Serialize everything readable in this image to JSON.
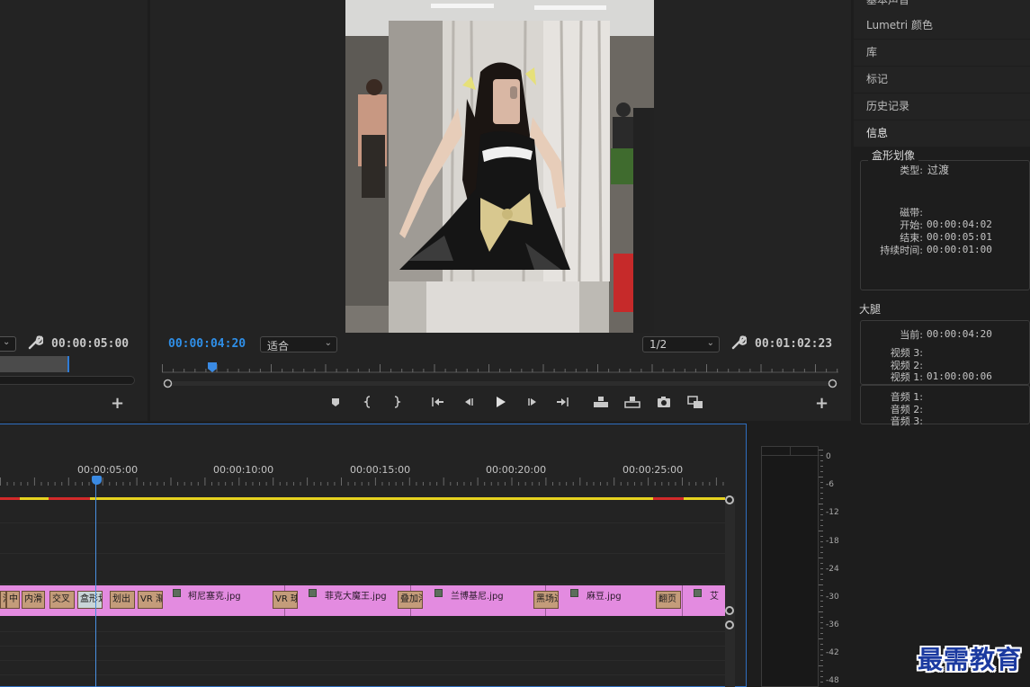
{
  "source_monitor": {
    "duration": "00:00:05:00",
    "add_label": "+"
  },
  "program_monitor": {
    "timecode": "00:00:04:20",
    "fit_option": "适合",
    "resolution": "1/2",
    "duration": "00:01:02:23",
    "add_label": "+",
    "transport_icons": [
      "marker-icon",
      "mark-in-icon",
      "mark-out-icon",
      "go-to-in-icon",
      "step-back-icon",
      "play-icon",
      "step-forward-icon",
      "go-to-out-icon",
      "lift-icon",
      "extract-icon",
      "export-frame-icon",
      "compare-icon"
    ]
  },
  "right_panel": {
    "top_cut_item": "基本声音",
    "items": [
      "Lumetri 颜色",
      "库",
      "标记",
      "历史记录",
      "信息"
    ],
    "info": {
      "title": "盒形划像",
      "type_label": "类型:",
      "type_value": "过渡",
      "tape_label": "磁带:",
      "start_label": "开始:",
      "start_value": "00:00:04:02",
      "end_label": "结束:",
      "end_value": "00:00:05:01",
      "duration_label": "持续时间:",
      "duration_value": "00:00:01:00"
    },
    "sequence": {
      "name": "大腿",
      "current_label": "当前:",
      "current_value": "00:00:04:20",
      "video3_label": "视频 3:",
      "video2_label": "视频 2:",
      "video1_label": "视频 1:",
      "video1_value": "01:00:00:06",
      "audio1_label": "音频 1:",
      "audio2_label": "音频 2:",
      "audio3_label": "音频 3:"
    }
  },
  "timeline": {
    "ruler_labels": [
      "00:00:05:00",
      "00:00:10:00",
      "00:00:15:00",
      "00:00:20:00",
      "00:00:25:00"
    ],
    "clips": [
      "柯尼塞克.jpg",
      "菲克大魔王.jpg",
      "兰博基尼.jpg",
      "麻豆.jpg",
      "艾"
    ],
    "transitions": [
      "溶",
      "中",
      "内滑",
      "交叉",
      "盒形划",
      "划出",
      "VR 渐",
      "VR 球",
      "叠加溶",
      "黑场过",
      "翻页"
    ]
  },
  "audio_meter": {
    "db_labels": [
      "0",
      "-6",
      "-12",
      "-18",
      "-24",
      "-30",
      "-36",
      "-42",
      "-48"
    ]
  },
  "watermark": "最需教育",
  "colors": {
    "accent_blue": "#2f8fe8",
    "clip_pink": "#e38be0",
    "transition_tan": "#c49c7a",
    "workbar_yellow": "#e6d21f",
    "workbar_red": "#d22a2a"
  }
}
